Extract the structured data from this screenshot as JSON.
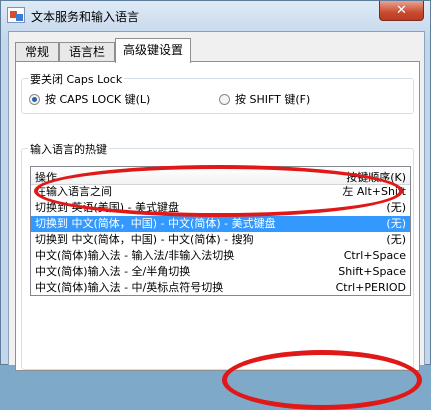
{
  "window": {
    "title": "文本服务和输入语言",
    "close_label": "✕"
  },
  "tabs": [
    {
      "label": "常规"
    },
    {
      "label": "语言栏"
    },
    {
      "label": "高级键设置"
    }
  ],
  "caps_lock": {
    "label": "要关闭 Caps Lock",
    "option1": "按 CAPS LOCK 键(L)",
    "option2": "按 SHIFT 键(F)",
    "selected": "option1"
  },
  "hotkeys": {
    "label": "输入语言的热键",
    "col_action": "操作",
    "col_keys": "按键顺序(K)",
    "rows": [
      {
        "action": "在输入语言之间",
        "keys": "左 Alt+Shift"
      },
      {
        "action": "切换到 英语(美国) - 美式键盘",
        "keys": "(无)"
      },
      {
        "action": "切换到 中文(简体，中国) - 中文(简体) - 美式键盘",
        "keys": "(无)"
      },
      {
        "action": "切换到 中文(简体，中国) - 中文(简体) - 搜狗",
        "keys": "(无)"
      },
      {
        "action": "中文(简体)输入法 - 输入法/非输入法切换",
        "keys": "Ctrl+Space"
      },
      {
        "action": "中文(简体)输入法 - 全/半角切换",
        "keys": "Shift+Space"
      },
      {
        "action": "中文(简体)输入法 - 中/英标点符号切换",
        "keys": "Ctrl+PERIOD"
      }
    ],
    "selected_row": 2
  },
  "colors": {
    "selection": "#3399ff",
    "annotation": "#e01818"
  }
}
